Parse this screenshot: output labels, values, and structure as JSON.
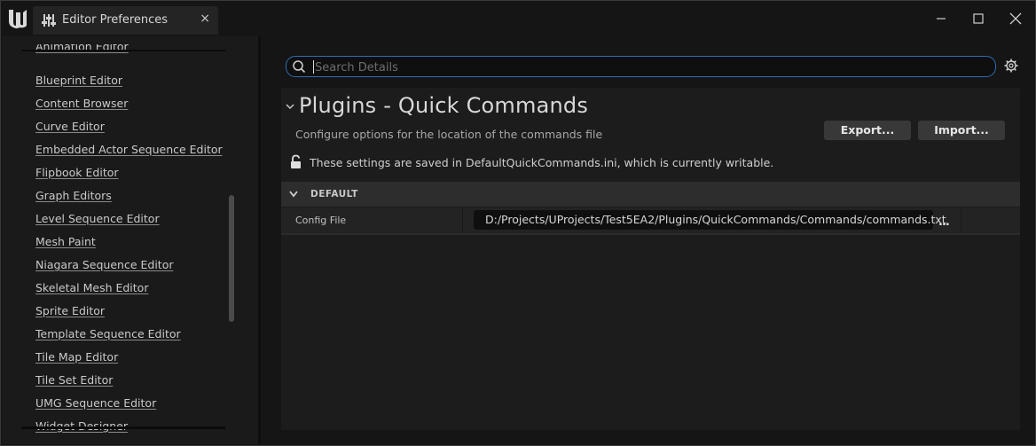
{
  "window": {
    "tab_title": "Editor Preferences",
    "tab_close": "×"
  },
  "sidebar": {
    "items": [
      {
        "label": "Animation Editor"
      },
      {
        "label": "Blueprint Editor"
      },
      {
        "label": "Content Browser"
      },
      {
        "label": "Curve Editor"
      },
      {
        "label": "Embedded Actor Sequence Editor"
      },
      {
        "label": "Flipbook Editor"
      },
      {
        "label": "Graph Editors"
      },
      {
        "label": "Level Sequence Editor"
      },
      {
        "label": "Mesh Paint"
      },
      {
        "label": "Niagara Sequence Editor"
      },
      {
        "label": "Skeletal Mesh Editor"
      },
      {
        "label": "Sprite Editor"
      },
      {
        "label": "Template Sequence Editor"
      },
      {
        "label": "Tile Map Editor"
      },
      {
        "label": "Tile Set Editor"
      },
      {
        "label": "UMG Sequence Editor"
      },
      {
        "label": "Widget Designer"
      }
    ]
  },
  "search": {
    "placeholder": "Search Details",
    "value": ""
  },
  "section": {
    "title": "Plugins - Quick Commands",
    "description": "Configure options for the location of the commands file",
    "export_label": "Export...",
    "import_label": "Import...",
    "saved_notice": "These settings are saved in DefaultQuickCommands.ini, which is currently writable."
  },
  "category": {
    "label": "DEFAULT",
    "properties": [
      {
        "name": "Config File",
        "value": "D:/Projects/UProjects/Test5EA2/Plugins/QuickCommands/Commands/commands.txt",
        "browse_label": "..."
      }
    ]
  },
  "colors": {
    "accent": "#2d6fb0",
    "background": "#151515",
    "panel": "#1c1c1c",
    "category_header": "#2d2d2d"
  }
}
